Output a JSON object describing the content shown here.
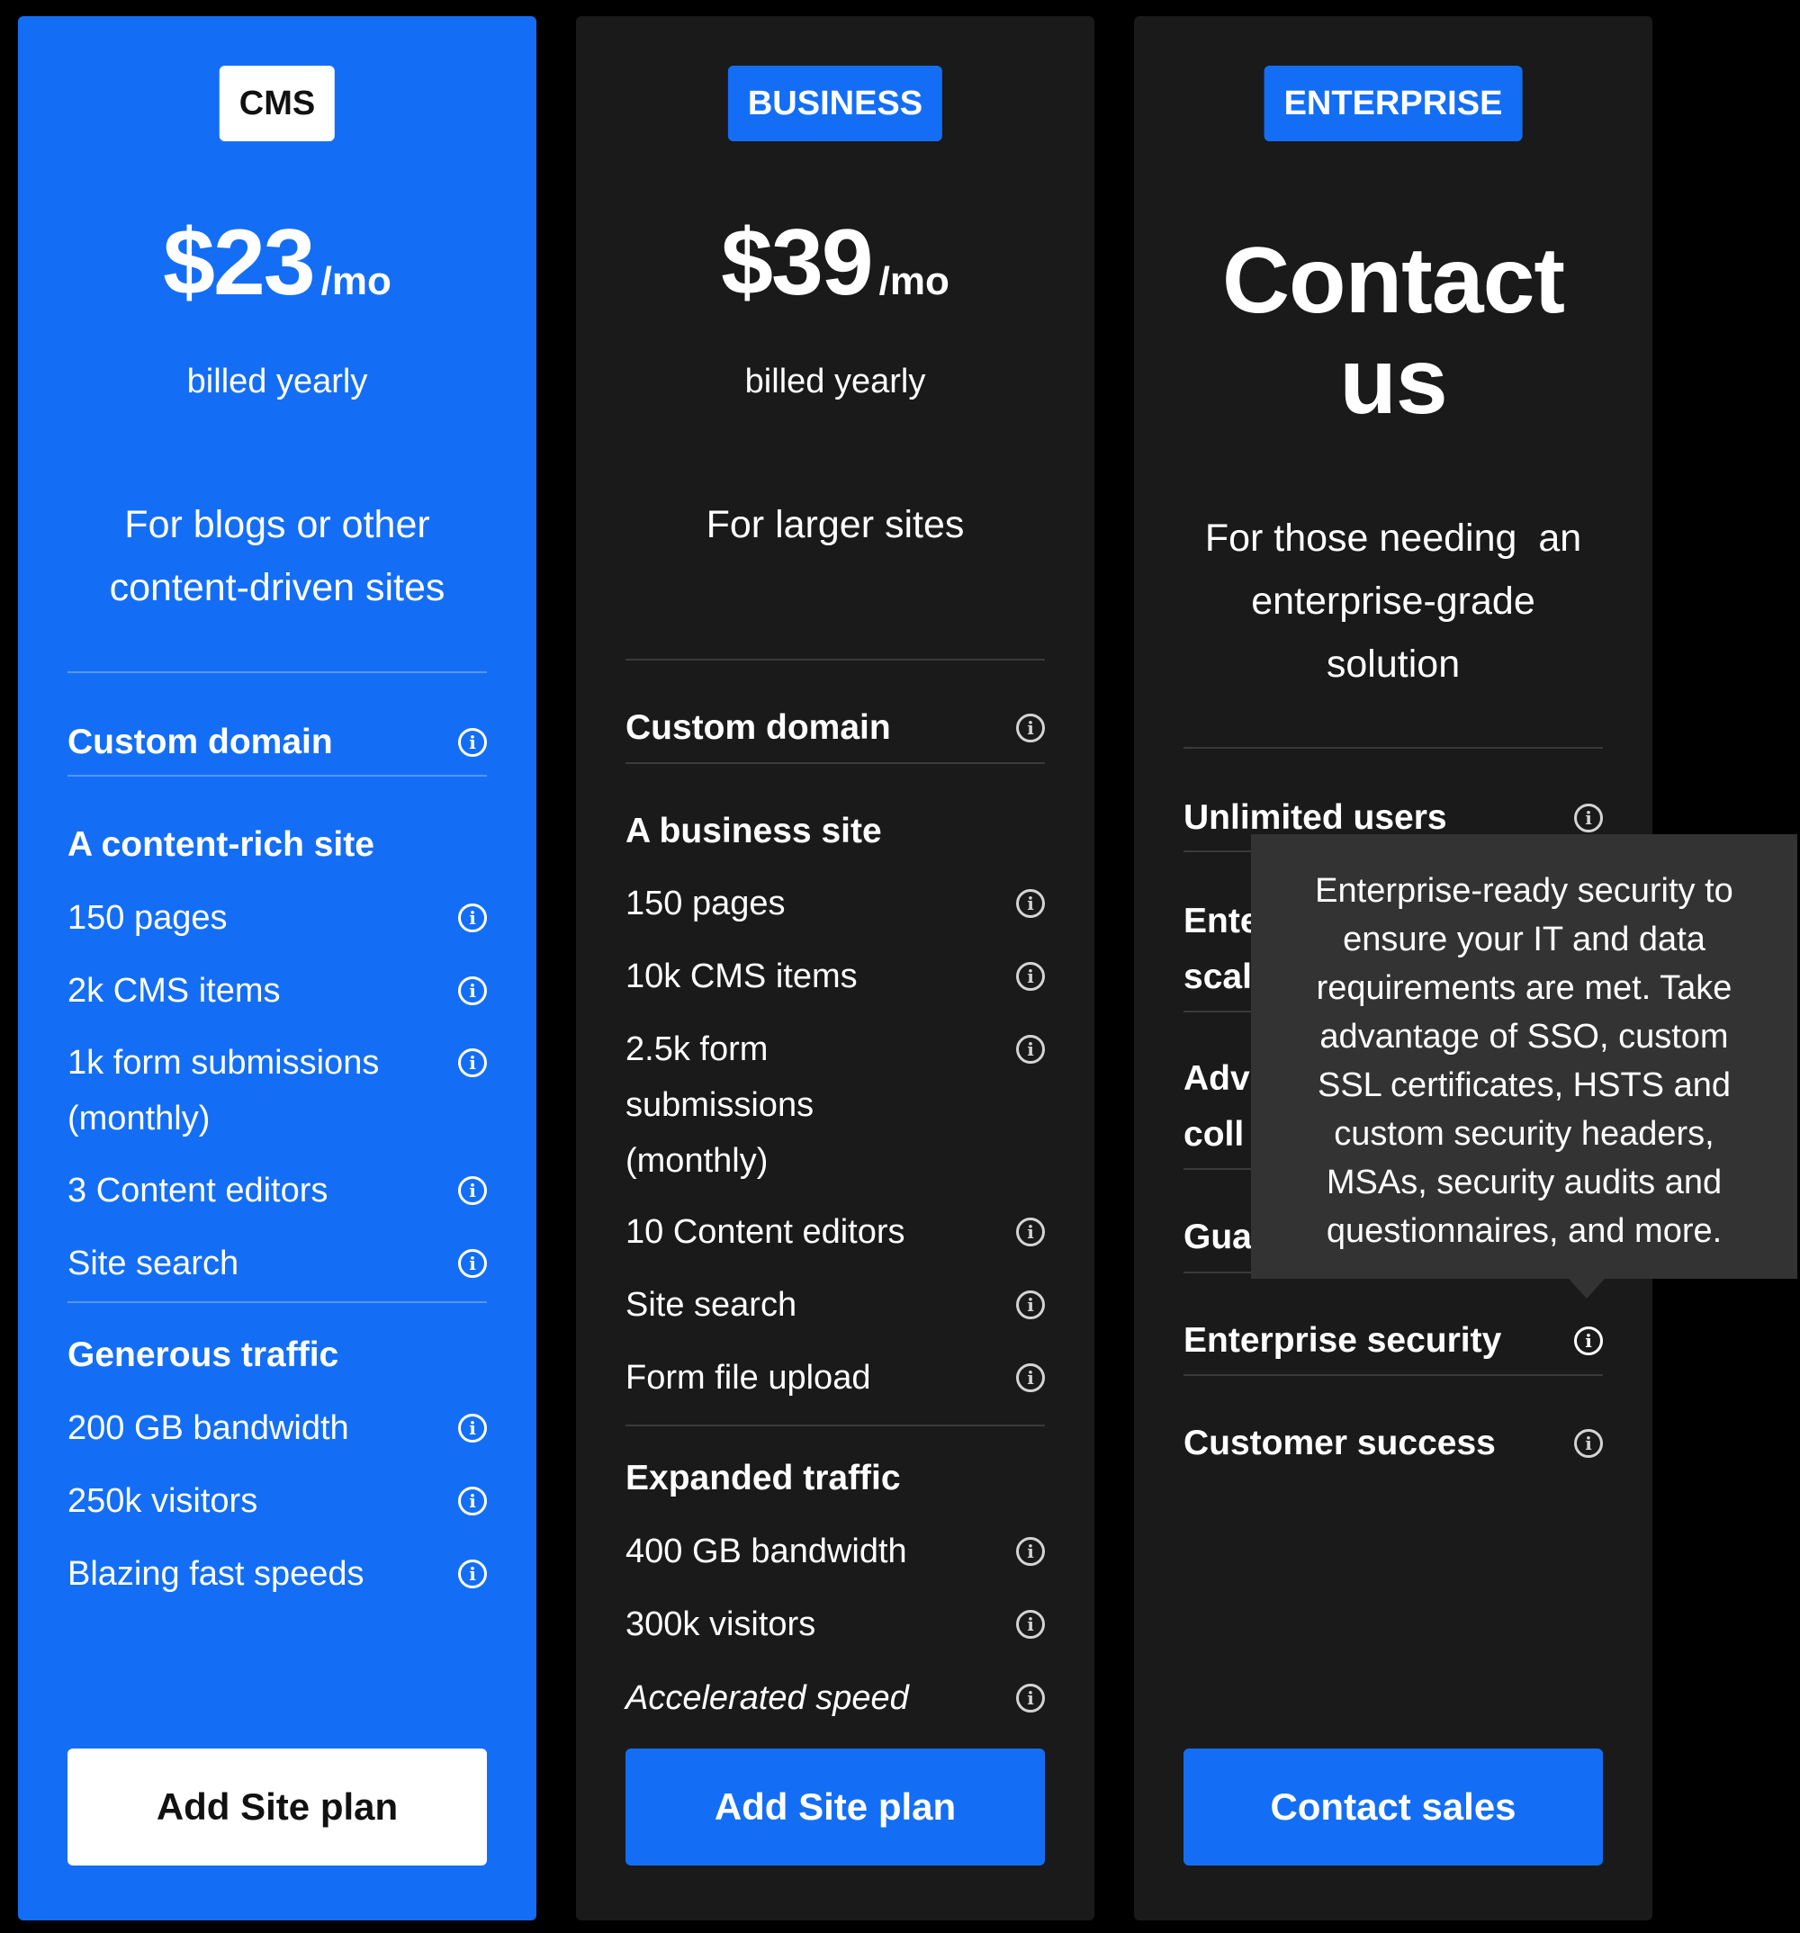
{
  "cms": {
    "badge": "CMS",
    "price": "$23",
    "per": "/mo",
    "billed": "billed yearly",
    "tagline_line1": "For blogs or other",
    "tagline_line2": "content-driven sites",
    "custom_domain": "Custom domain",
    "section1": "A content-rich site",
    "items1": [
      "150 pages",
      "2k CMS items",
      "1k form submissions",
      "(monthly)",
      "3 Content editors",
      "Site search"
    ],
    "section2": "Generous traffic",
    "items2": [
      "200 GB bandwidth",
      "250k visitors",
      "Blazing fast speeds"
    ],
    "cta": "Add Site plan"
  },
  "business": {
    "badge": "BUSINESS",
    "price": "$39",
    "per": "/mo",
    "billed": "billed yearly",
    "tagline": "For larger sites",
    "custom_domain": "Custom domain",
    "section1": "A business site",
    "items1": [
      "150 pages",
      "10k CMS items",
      "2.5k form",
      "submissions",
      "(monthly)",
      "10 Content editors",
      "Site search",
      "Form file upload"
    ],
    "section2": "Expanded traffic",
    "items2": [
      "400 GB bandwidth",
      "300k visitors",
      "Accelerated speed"
    ],
    "cta": "Add Site plan"
  },
  "enterprise": {
    "badge": "ENTERPRISE",
    "title_line1": "Contact",
    "title_line2": "us",
    "tagline_line1": "For those needing  an",
    "tagline_line2": "enterprise-grade",
    "tagline_line3": "solution",
    "items": [
      "Unlimited users",
      "Ente",
      "scal",
      "Adv",
      "coll",
      "Gua",
      "Enterprise security",
      "Customer success"
    ],
    "cta": "Contact sales"
  },
  "tooltip": {
    "lines": [
      "Enterprise-ready security to",
      "ensure your IT and data",
      "requirements are met. Take",
      "advantage of SSO, custom",
      "SSL certificates, HSTS and",
      "custom security headers,",
      "MSAs, security audits and",
      "questionnaires, and more."
    ]
  },
  "icons": {
    "info": "i"
  },
  "colors": {
    "accent": "#146ef5",
    "card_dark": "#1a1a1a",
    "tooltip_bg": "#333333",
    "page_bg": "#000000"
  }
}
